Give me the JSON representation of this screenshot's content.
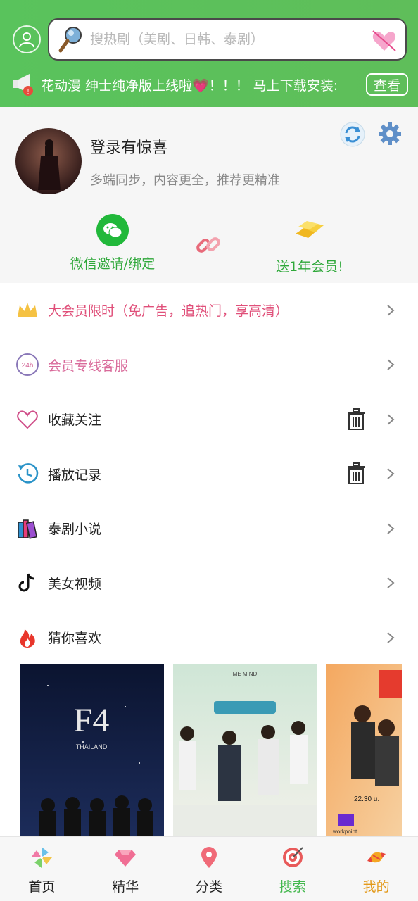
{
  "header": {
    "search_placeholder": "搜热剧（美剧、日韩、泰剧）",
    "notice_text": "花动漫 绅士纯净版上线啦💗！！！  马上下载安装: ",
    "notice_button": "查看"
  },
  "profile": {
    "title": "登录有惊喜",
    "subtitle": "多端同步，内容更全，推荐更精准",
    "wechat_label": "微信邀请/绑定",
    "vip_label": "送1年会员!"
  },
  "menu": [
    {
      "label": "大会员限时（免广告，追热门，享高清）",
      "color": "#e0507a"
    },
    {
      "label": "会员专线客服",
      "color": "#d96a9a"
    },
    {
      "label": "收藏关注",
      "color": "#222222"
    },
    {
      "label": "播放记录",
      "color": "#222222"
    },
    {
      "label": "泰剧小说",
      "color": "#222222"
    },
    {
      "label": "美女视频",
      "color": "#222222"
    },
    {
      "label": "猜你喜欢",
      "color": "#222222"
    }
  ],
  "posters": {
    "p1": {
      "title": "F4",
      "subtitle": "THAILAND"
    },
    "p2": {
      "brand": "ME MIND"
    },
    "p3": {
      "brand": "workpoint",
      "time": "22.30 u."
    }
  },
  "tabbar": [
    {
      "label": "首页",
      "color": "#222222"
    },
    {
      "label": "精华",
      "color": "#222222"
    },
    {
      "label": "分类",
      "color": "#222222"
    },
    {
      "label": "搜索",
      "color": "#44b84e"
    },
    {
      "label": "我的",
      "color": "#e39a1b"
    }
  ],
  "colors": {
    "header_green": "#59c35c",
    "accent_green": "#2fa83a"
  }
}
